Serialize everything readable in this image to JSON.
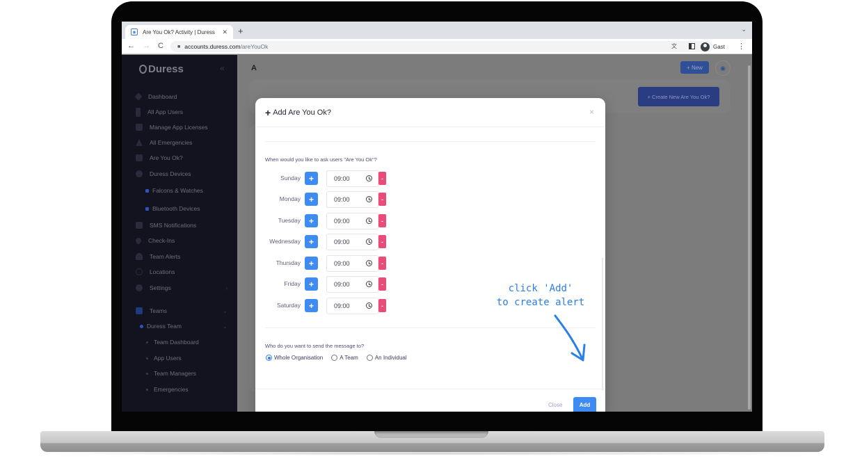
{
  "browser": {
    "tab_title": "Are You Ok? Activity | Duress",
    "tab_close": "✕",
    "new_tab": "+",
    "tabs_menu": "⌄",
    "back": "←",
    "forward": "→",
    "reload": "C",
    "lock": "🔒",
    "url_host": "accounts.duress.com",
    "url_path": "/areYouOk",
    "translate": "文",
    "profile_name": "Gast",
    "menu": "⋮"
  },
  "sidebar": {
    "brand": "Duress",
    "collapse": "«",
    "items": [
      {
        "label": "Dashboard"
      },
      {
        "label": "All App Users"
      },
      {
        "label": "Manage App Licenses"
      },
      {
        "label": "All Emergencies"
      },
      {
        "label": "Are You Ok?"
      },
      {
        "label": "Duress Devices"
      },
      {
        "label": "Falcons & Watches"
      },
      {
        "label": "Bluetooth Devices"
      },
      {
        "label": "SMS Notifications"
      },
      {
        "label": "Check-Ins"
      },
      {
        "label": "Team Alerts"
      },
      {
        "label": "Locations"
      },
      {
        "label": "Settings"
      },
      {
        "label": "Teams"
      },
      {
        "label": "Duress Team"
      },
      {
        "label": "Team Dashboard"
      },
      {
        "label": "App Users"
      },
      {
        "label": "Team Managers"
      },
      {
        "label": "Emergencies"
      }
    ]
  },
  "main": {
    "title_partial": "A",
    "new_button": "+ New",
    "create_button": "+ Create New Are You Ok?"
  },
  "modal": {
    "title": "Add Are You Ok?",
    "close": "×",
    "schedule_question": "When would you like to ask users \"Are You Ok\"?",
    "days": [
      {
        "name": "Sunday",
        "time": "09:00"
      },
      {
        "name": "Monday",
        "time": "09:00"
      },
      {
        "name": "Tuesday",
        "time": "09:00"
      },
      {
        "name": "Wednesday",
        "time": "09:00"
      },
      {
        "name": "Thursday",
        "time": "09:00"
      },
      {
        "name": "Friday",
        "time": "09:00"
      },
      {
        "name": "Saturday",
        "time": "09:00"
      }
    ],
    "add_time_label": "+",
    "remove_time_label": "-",
    "recipient_question": "Who do you want to send the message to?",
    "recipient_options": [
      "Whole Organisation",
      "A Team",
      "An Individual"
    ],
    "recipient_selected": "Whole Organisation",
    "close_button": "Close",
    "add_button": "Add"
  },
  "annotation": {
    "line1": "click 'Add'",
    "line2": "to create alert",
    "color": "#2a7fe9"
  }
}
